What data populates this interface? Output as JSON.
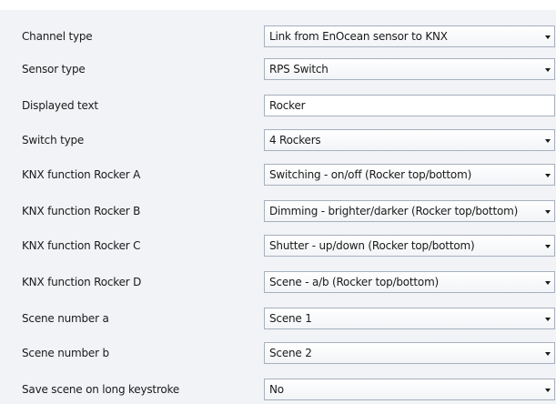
{
  "rows": [
    {
      "label": "Channel type",
      "value": "Link from EnOcean sensor to KNX",
      "kind": "dropdown"
    },
    {
      "label": "Sensor type",
      "value": "RPS Switch",
      "kind": "dropdown"
    },
    {
      "label": "Displayed text",
      "value": "Rocker",
      "kind": "text"
    },
    {
      "label": "Switch type",
      "value": "4 Rockers",
      "kind": "dropdown"
    },
    {
      "label": "KNX function Rocker A",
      "value": "Switching - on/off (Rocker top/bottom)",
      "kind": "dropdown"
    },
    {
      "label": "KNX function Rocker B",
      "value": "Dimming - brighter/darker (Rocker top/bottom)",
      "kind": "dropdown"
    },
    {
      "label": "KNX function Rocker C",
      "value": "Shutter - up/down (Rocker top/bottom)",
      "kind": "dropdown"
    },
    {
      "label": "KNX function Rocker D",
      "value": "Scene - a/b (Rocker top/bottom)",
      "kind": "dropdown"
    },
    {
      "label": "Scene number a",
      "value": "Scene 1",
      "kind": "dropdown"
    },
    {
      "label": "Scene number b",
      "value": "Scene 2",
      "kind": "dropdown"
    },
    {
      "label": "Save scene on long keystroke",
      "value": "No",
      "kind": "dropdown"
    }
  ],
  "icons": {
    "dropdown": "chevron-down-icon"
  },
  "colors": {
    "panel_background": "#f1f3f6",
    "field_border": "#a7b0bd",
    "text": "#1a1a1a"
  }
}
